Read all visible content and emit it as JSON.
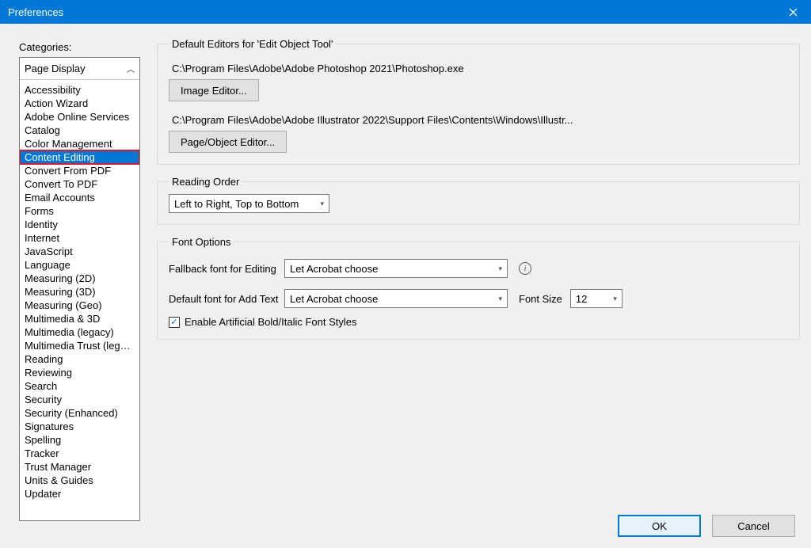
{
  "window": {
    "title": "Preferences"
  },
  "sidebar": {
    "label": "Categories:",
    "top_item": "Page Display",
    "selected_index": 5,
    "items": [
      "Accessibility",
      "Action Wizard",
      "Adobe Online Services",
      "Catalog",
      "Color Management",
      "Content Editing",
      "Convert From PDF",
      "Convert To PDF",
      "Email Accounts",
      "Forms",
      "Identity",
      "Internet",
      "JavaScript",
      "Language",
      "Measuring (2D)",
      "Measuring (3D)",
      "Measuring (Geo)",
      "Multimedia & 3D",
      "Multimedia (legacy)",
      "Multimedia Trust (legacy)",
      "Reading",
      "Reviewing",
      "Search",
      "Security",
      "Security (Enhanced)",
      "Signatures",
      "Spelling",
      "Tracker",
      "Trust Manager",
      "Units & Guides",
      "Updater"
    ]
  },
  "default_editors": {
    "legend": "Default Editors for 'Edit Object Tool'",
    "image_path": "C:\\Program Files\\Adobe\\Adobe Photoshop 2021\\Photoshop.exe",
    "image_button": "Image Editor...",
    "page_path": "C:\\Program Files\\Adobe\\Adobe Illustrator 2022\\Support Files\\Contents\\Windows\\Illustr...",
    "page_button": "Page/Object Editor..."
  },
  "reading_order": {
    "legend": "Reading Order",
    "value": "Left to Right, Top to Bottom"
  },
  "font_options": {
    "legend": "Font Options",
    "fallback_label": "Fallback font for Editing",
    "fallback_value": "Let Acrobat choose",
    "default_label": "Default font for Add Text",
    "default_value": "Let Acrobat choose",
    "font_size_label": "Font Size",
    "font_size_value": "12",
    "checkbox_label": "Enable Artificial Bold/Italic Font Styles",
    "checkbox_checked": true
  },
  "footer": {
    "ok": "OK",
    "cancel": "Cancel"
  }
}
